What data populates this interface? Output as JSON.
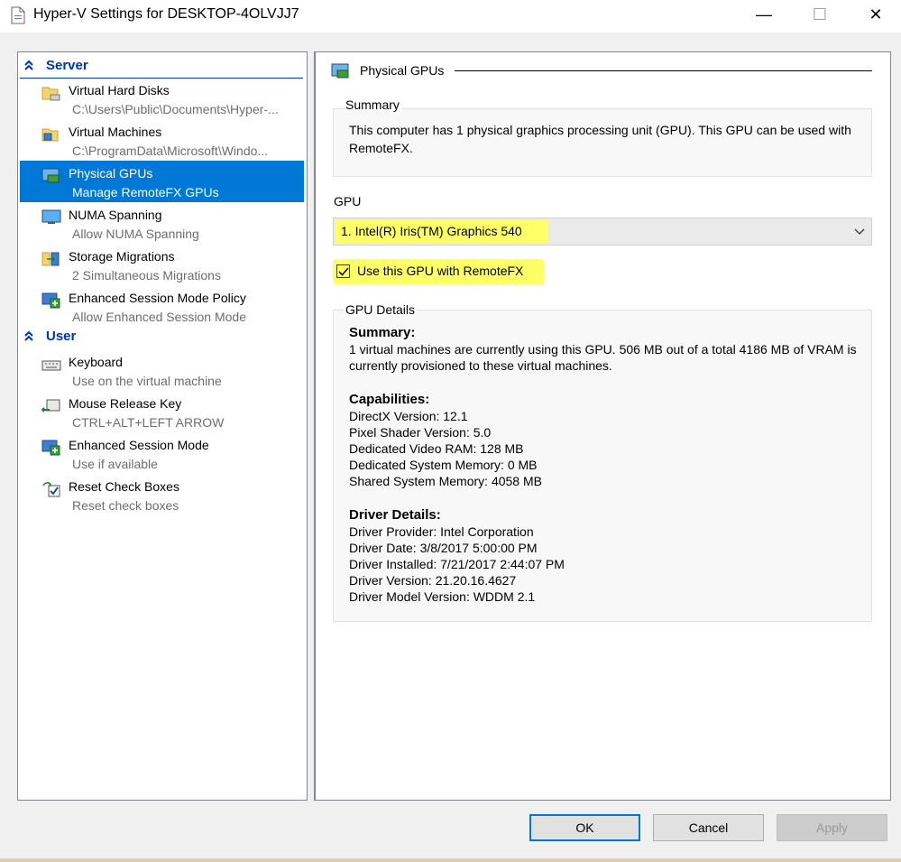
{
  "window": {
    "title": "Hyper-V Settings for DESKTOP-4OLVJJ7",
    "min_glyph": "—",
    "max_glyph": "☐",
    "close_glyph": "✕"
  },
  "sidebar": {
    "server_header": "Server",
    "user_header": "User",
    "items": [
      {
        "name": "Virtual Hard Disks",
        "sub": "C:\\Users\\Public\\Documents\\Hyper-...",
        "icon": "folder-disk-icon"
      },
      {
        "name": "Virtual Machines",
        "sub": "C:\\ProgramData\\Microsoft\\Windo...",
        "icon": "folder-vm-icon"
      },
      {
        "name": "Physical GPUs",
        "sub": "Manage RemoteFX GPUs",
        "icon": "gpu-icon",
        "selected": true
      },
      {
        "name": "NUMA Spanning",
        "sub": "Allow NUMA Spanning",
        "icon": "monitor-icon"
      },
      {
        "name": "Storage Migrations",
        "sub": "2 Simultaneous Migrations",
        "icon": "storage-icon"
      },
      {
        "name": "Enhanced Session Mode Policy",
        "sub": "Allow Enhanced Session Mode",
        "icon": "session-policy-icon"
      },
      {
        "name": "Keyboard",
        "sub": "Use on the virtual machine",
        "icon": "keyboard-icon"
      },
      {
        "name": "Mouse Release Key",
        "sub": "CTRL+ALT+LEFT ARROW",
        "icon": "mouse-key-icon"
      },
      {
        "name": "Enhanced Session Mode",
        "sub": "Use if available",
        "icon": "session-icon"
      },
      {
        "name": "Reset Check Boxes",
        "sub": "Reset check boxes",
        "icon": "reset-checkbox-icon"
      }
    ]
  },
  "main": {
    "section_title": "Physical GPUs",
    "summary_label": "Summary",
    "summary_text": "This computer has 1 physical graphics processing unit (GPU). This GPU can be used with RemoteFX.",
    "gpu_label": "GPU",
    "gpu_selected": "1. Intel(R) Iris(TM) Graphics 540",
    "use_gpu_label": "Use this GPU with RemoteFX",
    "use_gpu_checked": true,
    "details_label": "GPU Details",
    "details": {
      "summary_header": "Summary:",
      "summary_text": "1 virtual machines are currently using this GPU. 506 MB out of a total 4186 MB of VRAM is currently provisioned to these virtual machines.",
      "capabilities_header": "Capabilities:",
      "capabilities": [
        "DirectX Version: 12.1",
        "Pixel Shader Version: 5.0",
        "Dedicated Video RAM: 128 MB",
        "Dedicated System Memory: 0 MB",
        "Shared System Memory: 4058 MB"
      ],
      "driver_header": "Driver Details:",
      "driver": [
        "Driver Provider: Intel Corporation",
        "Driver Date: 3/8/2017 5:00:00 PM",
        "Driver Installed: 7/21/2017 2:44:07 PM",
        "Driver Version: 21.20.16.4627",
        "Driver Model Version: WDDM 2.1"
      ]
    }
  },
  "buttons": {
    "ok": "OK",
    "cancel": "Cancel",
    "apply": "Apply"
  },
  "colors": {
    "selection": "#0078d7",
    "highlight": "#ffff66",
    "section_header": "#0033bb"
  }
}
